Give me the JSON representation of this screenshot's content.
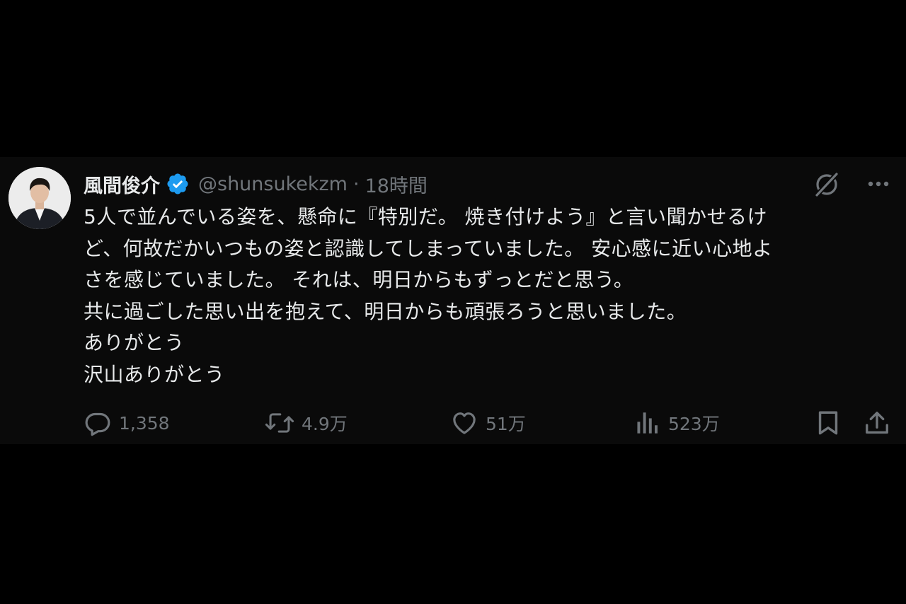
{
  "colors": {
    "page_background": "#000000",
    "card_background": "#0a0a0a",
    "primary_text": "#e7e9ea",
    "secondary_text": "#71767b",
    "verified_badge": "#1d9bf0"
  },
  "post": {
    "author": {
      "display_name": "風間俊介",
      "handle": "@shunsukekzm",
      "verified": true,
      "avatar_icon": "user-avatar"
    },
    "separator": "·",
    "timestamp": "18時間",
    "header_icons": [
      "grok-icon",
      "more-icon"
    ],
    "text_lines": [
      "5人で並んでいる姿を、懸命に『特別だ。 焼き付けよう』と言い聞かせるけ",
      "ど、何故だかいつもの姿と認識してしまっていました。 安心感に近い心地よ",
      "さを感じていました。 それは、明日からもずっとだと思う。",
      "共に過ごした思い出を抱えて、明日からも頑張ろうと思いました。",
      "ありがとう",
      "沢山ありがとう"
    ],
    "actions": {
      "reply_count": "1,358",
      "repost_count": "4.9万",
      "like_count": "51万",
      "views_count": "523万"
    }
  }
}
